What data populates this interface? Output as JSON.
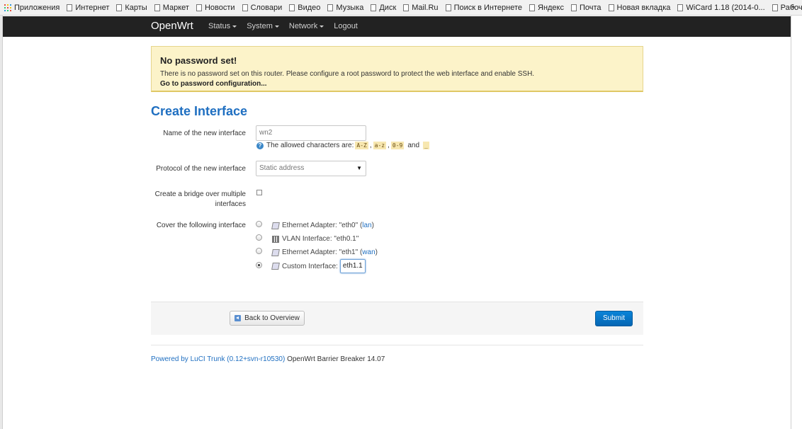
{
  "bookmarks": {
    "apps_label": "Приложения",
    "items": [
      "Интернет",
      "Карты",
      "Маркет",
      "Новости",
      "Словари",
      "Видео",
      "Музыка",
      "Диск",
      "Mail.Ru",
      "Поиск в Интернете",
      "Яндекс",
      "Почта",
      "Новая вкладка",
      "WiCard 1.18 (2014-0...",
      "Рабочие конфиги д..."
    ],
    "more": "»"
  },
  "navbar": {
    "brand": "OpenWrt",
    "menu": [
      "Status",
      "System",
      "Network"
    ],
    "logout": "Logout"
  },
  "alert": {
    "title": "No password set!",
    "text": "There is no password set on this router. Please configure a root password to protect the web interface and enable SSH.",
    "link": "Go to password configuration..."
  },
  "page_title": "Create Interface",
  "form": {
    "name_label": "Name of the new interface",
    "name_value": "wn2",
    "hint_prefix": "The allowed characters are:",
    "hint_codes": [
      "A-Z",
      "a-z",
      "0-9"
    ],
    "hint_and": "and",
    "hint_last": "_",
    "protocol_label": "Protocol of the new interface",
    "protocol_value": "Static address",
    "bridge_label": "Create a bridge over multiple interfaces",
    "cover_label": "Cover the following interface",
    "interfaces": [
      {
        "text": "Ethernet Adapter: \"eth0\"",
        "link": "lan",
        "selected": false
      },
      {
        "text": "VLAN Interface: \"eth0.1\"",
        "link": "",
        "selected": false
      },
      {
        "text": "Ethernet Adapter: \"eth1\"",
        "link": "wan",
        "selected": false
      },
      {
        "text": "Custom Interface:",
        "link": "",
        "selected": true
      }
    ],
    "custom_value": "eth1.1"
  },
  "actions": {
    "back_label": "Back to Overview",
    "submit_label": "Submit"
  },
  "footer": {
    "link": "Powered by LuCI Trunk (0.12+svn-r10530)",
    "text": "OpenWrt Barrier Breaker 14.07"
  },
  "colors": {
    "accent": "#1f6fc1",
    "navbar": "#222222",
    "alert_bg": "#fcf3c9",
    "submit": "#0a77c6"
  }
}
